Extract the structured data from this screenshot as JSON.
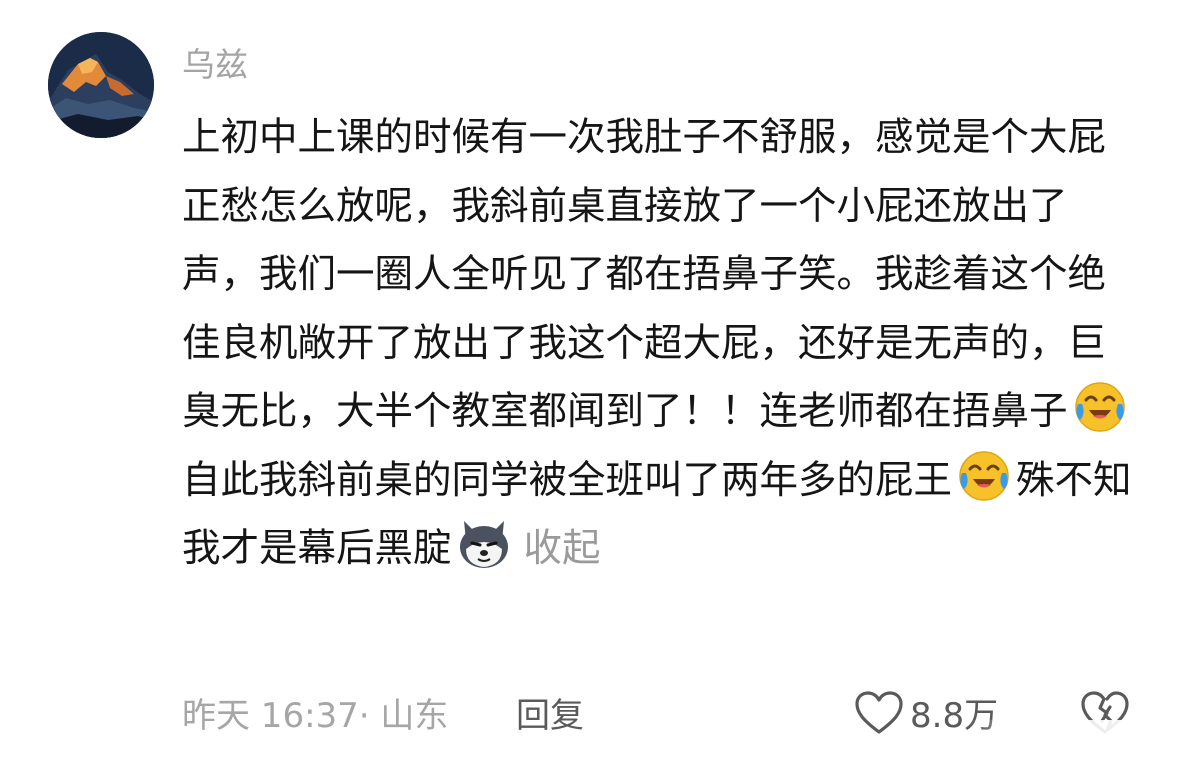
{
  "comment": {
    "username": "乌兹",
    "text_parts": [
      "上初中上课的时候有一次我肚子不舒服，感觉是个大屁正愁怎么放呢，我斜前桌直接放了一个小屁还放出了声，我们一圈人全听见了都在捂鼻子笑。我趁着这个绝佳良机敞开了放出了我这个超大屁，还好是无声的，巨臭无比，大半个教室都闻到了！！连老师都在捂鼻子",
      "自此我斜前桌的同学被全班叫了两年多的屁王",
      "殊不知我才是幕后黑腚"
    ],
    "emojis": [
      "laugh-cry-emoji",
      "laugh-cry-emoji",
      "husky-dog-emoji"
    ],
    "collapse_label": "收起",
    "time_location": "昨天 16:37· 山东",
    "reply_label": "回复",
    "like_count": "8.8万"
  },
  "colors": {
    "username": "#a4a4a4",
    "text": "#151515",
    "meta": "#a6a6a6",
    "action": "#5a5a5a",
    "emoji_face": "#f7c12a",
    "emoji_tear": "#3a9ce8"
  }
}
